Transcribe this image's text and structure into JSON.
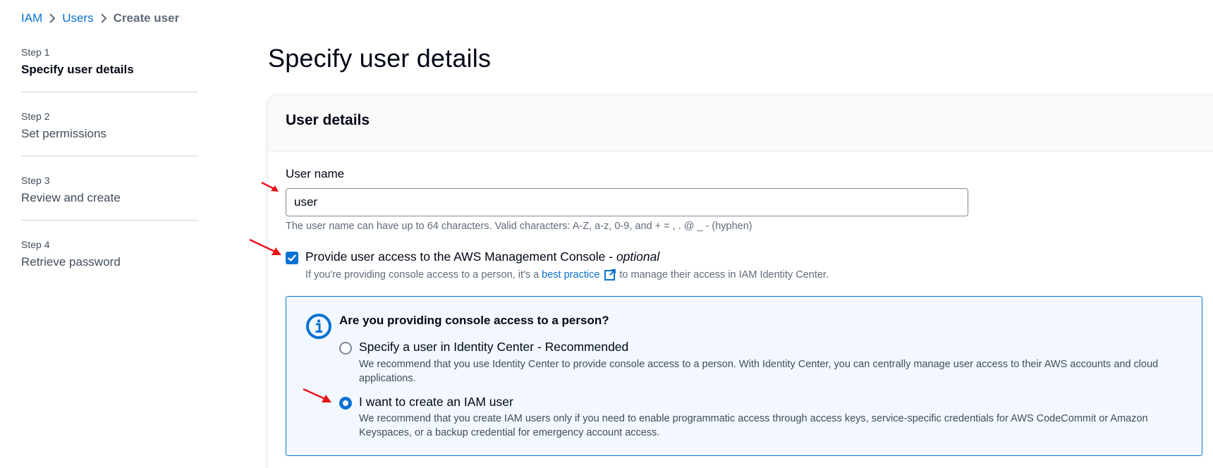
{
  "breadcrumb": {
    "items": [
      "IAM",
      "Users"
    ],
    "current": "Create user"
  },
  "steps": [
    {
      "num": "Step 1",
      "title": "Specify user details",
      "active": true
    },
    {
      "num": "Step 2",
      "title": "Set permissions",
      "active": false
    },
    {
      "num": "Step 3",
      "title": "Review and create",
      "active": false
    },
    {
      "num": "Step 4",
      "title": "Retrieve password",
      "active": false
    }
  ],
  "page": {
    "title": "Specify user details"
  },
  "user_details": {
    "header": "User details",
    "username_label": "User name",
    "username_value": "user",
    "username_constraint": "The user name can have up to 64 characters. Valid characters: A-Z, a-z, 0-9, and + = , . @ _ - (hyphen)",
    "console_checkbox_label": "Provide user access to the AWS Management Console - ",
    "console_checkbox_optional": "optional",
    "console_checkbox_checked": true,
    "console_desc_prefix": "If you're providing console access to a person, it's a",
    "console_desc_link": "best practice",
    "console_desc_suffix": "to manage their access in IAM Identity Center."
  },
  "alert": {
    "icon": "info-icon",
    "title": "Are you providing console access to a person?",
    "options": [
      {
        "label": "Specify a user in Identity Center - Recommended",
        "description": "We recommend that you use Identity Center to provide console access to a person. With Identity Center, you can centrally manage user access to their AWS accounts and cloud applications.",
        "selected": false
      },
      {
        "label": "I want to create an IAM user",
        "description": "We recommend that you create IAM users only if you need to enable programmatic access through access keys, service-specific credentials for AWS CodeCommit or Amazon Keyspaces, or a backup credential for emergency account access.",
        "selected": true
      }
    ]
  },
  "colors": {
    "accent": "#0972d3",
    "alert_bg": "#f2f8fd",
    "annotation": "#e8141b"
  }
}
